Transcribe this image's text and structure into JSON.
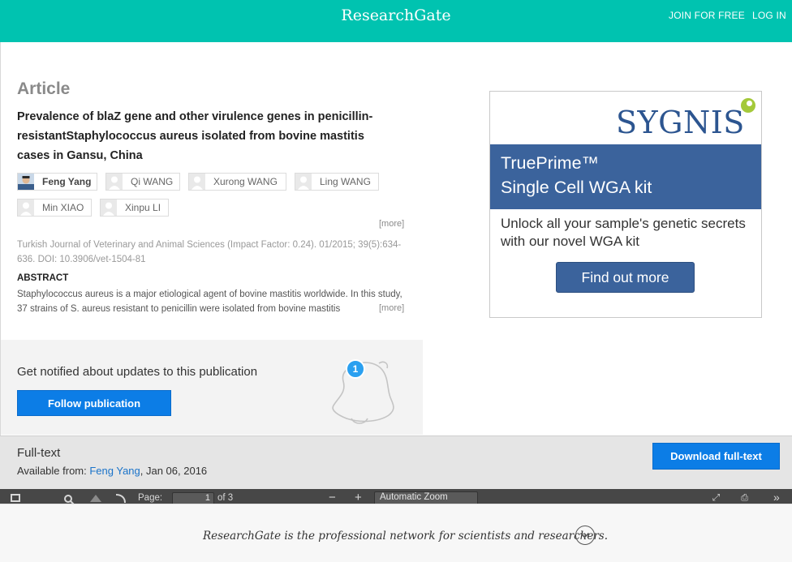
{
  "header": {
    "brand": "ResearchGate",
    "join_label": "JOIN FOR FREE",
    "login_label": "LOG IN",
    "bg_color": "#00c3b0"
  },
  "article": {
    "type_label": "Article",
    "title": "Prevalence of blaZ gene and other virulence genes in penicillin-resistantStaphylococcus aureus isolated from bovine mastitis cases in Gansu, China",
    "authors": [
      {
        "name": "Feng Yang",
        "has_photo": true
      },
      {
        "name": "Qi WANG",
        "has_photo": false
      },
      {
        "name": "Xurong WANG",
        "has_photo": false
      },
      {
        "name": "Ling WANG",
        "has_photo": false
      },
      {
        "name": "Min XIAO",
        "has_photo": false
      },
      {
        "name": "Xinpu LI",
        "has_photo": false
      }
    ],
    "authors_more_label": "[more]",
    "journal_info": "Turkish Journal of Veterinary and Animal Sciences (Impact Factor: 0.24). 01/2015; 39(5):634-636. DOI: 10.3906/vet-1504-81",
    "abstract_heading": "ABSTRACT",
    "abstract_text": "Staphylococcus aureus is a major etiological agent of bovine mastitis worldwide. In this study, 37 strains of S. aureus resistant to penicillin were isolated from bovine mastitis",
    "abstract_more_label": "[more]"
  },
  "notify": {
    "text": "Get notified about updates to this publication",
    "follow_label": "Follow publication",
    "badge_count": "1"
  },
  "ad": {
    "logo": "SYGNIS",
    "headline_line1": "TruePrime™",
    "headline_line2": "Single Cell WGA kit",
    "body": "Unlock all your sample's genetic secrets with our novel WGA kit",
    "button_label": "Find out more",
    "brand_color": "#3b639c"
  },
  "fulltext": {
    "title": "Full-text",
    "available_prefix": "Available from: ",
    "available_author": "Feng Yang",
    "available_suffix": ", Jan 06, 2016",
    "download_label": "Download full-text"
  },
  "pdf_toolbar": {
    "page_label": "Page:",
    "page_value": "1",
    "page_total": "of 3",
    "zoom_value": "Automatic Zoom"
  },
  "footer_banner": {
    "brand": "ResearchGate",
    "text": " is the professional network for scientists and researchers."
  }
}
